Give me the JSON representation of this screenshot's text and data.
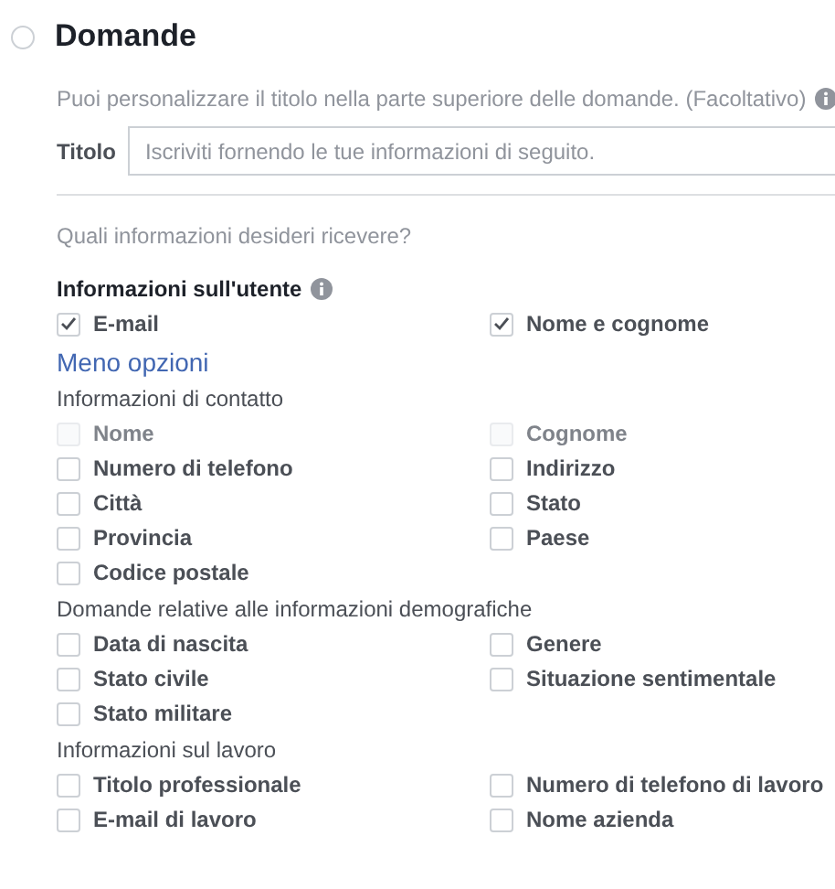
{
  "section": {
    "title": "Domande",
    "selected": false
  },
  "intro": "Puoi personalizzare il titolo nella parte superiore delle domande. (Facoltativo)",
  "title_field": {
    "label": "Titolo",
    "placeholder": "Iscriviti fornendo le tue informazioni di seguito."
  },
  "question": "Quali informazioni desideri ricevere?",
  "user_info": {
    "heading": "Informazioni sull'utente",
    "options": [
      {
        "label": "E-mail",
        "checked": true,
        "disabled": false
      },
      {
        "label": "Nome e cognome",
        "checked": true,
        "disabled": false
      }
    ]
  },
  "toggle_link": "Meno opzioni",
  "groups": [
    {
      "heading": "Informazioni di contatto",
      "options": [
        {
          "label": "Nome",
          "checked": false,
          "disabled": true
        },
        {
          "label": "Cognome",
          "checked": false,
          "disabled": true
        },
        {
          "label": "Numero di telefono",
          "checked": false,
          "disabled": false
        },
        {
          "label": "Indirizzo",
          "checked": false,
          "disabled": false
        },
        {
          "label": "Città",
          "checked": false,
          "disabled": false
        },
        {
          "label": "Stato",
          "checked": false,
          "disabled": false
        },
        {
          "label": "Provincia",
          "checked": false,
          "disabled": false
        },
        {
          "label": "Paese",
          "checked": false,
          "disabled": false
        },
        {
          "label": "Codice postale",
          "checked": false,
          "disabled": false
        }
      ]
    },
    {
      "heading": "Domande relative alle informazioni demografiche",
      "options": [
        {
          "label": "Data di nascita",
          "checked": false,
          "disabled": false
        },
        {
          "label": "Genere",
          "checked": false,
          "disabled": false
        },
        {
          "label": "Stato civile",
          "checked": false,
          "disabled": false
        },
        {
          "label": "Situazione sentimentale",
          "checked": false,
          "disabled": false
        },
        {
          "label": "Stato militare",
          "checked": false,
          "disabled": false
        }
      ]
    },
    {
      "heading": "Informazioni sul lavoro",
      "options": [
        {
          "label": "Titolo professionale",
          "checked": false,
          "disabled": false
        },
        {
          "label": "Numero di telefono di lavoro",
          "checked": false,
          "disabled": false
        },
        {
          "label": "E-mail di lavoro",
          "checked": false,
          "disabled": false
        },
        {
          "label": "Nome azienda",
          "checked": false,
          "disabled": false
        }
      ]
    }
  ]
}
